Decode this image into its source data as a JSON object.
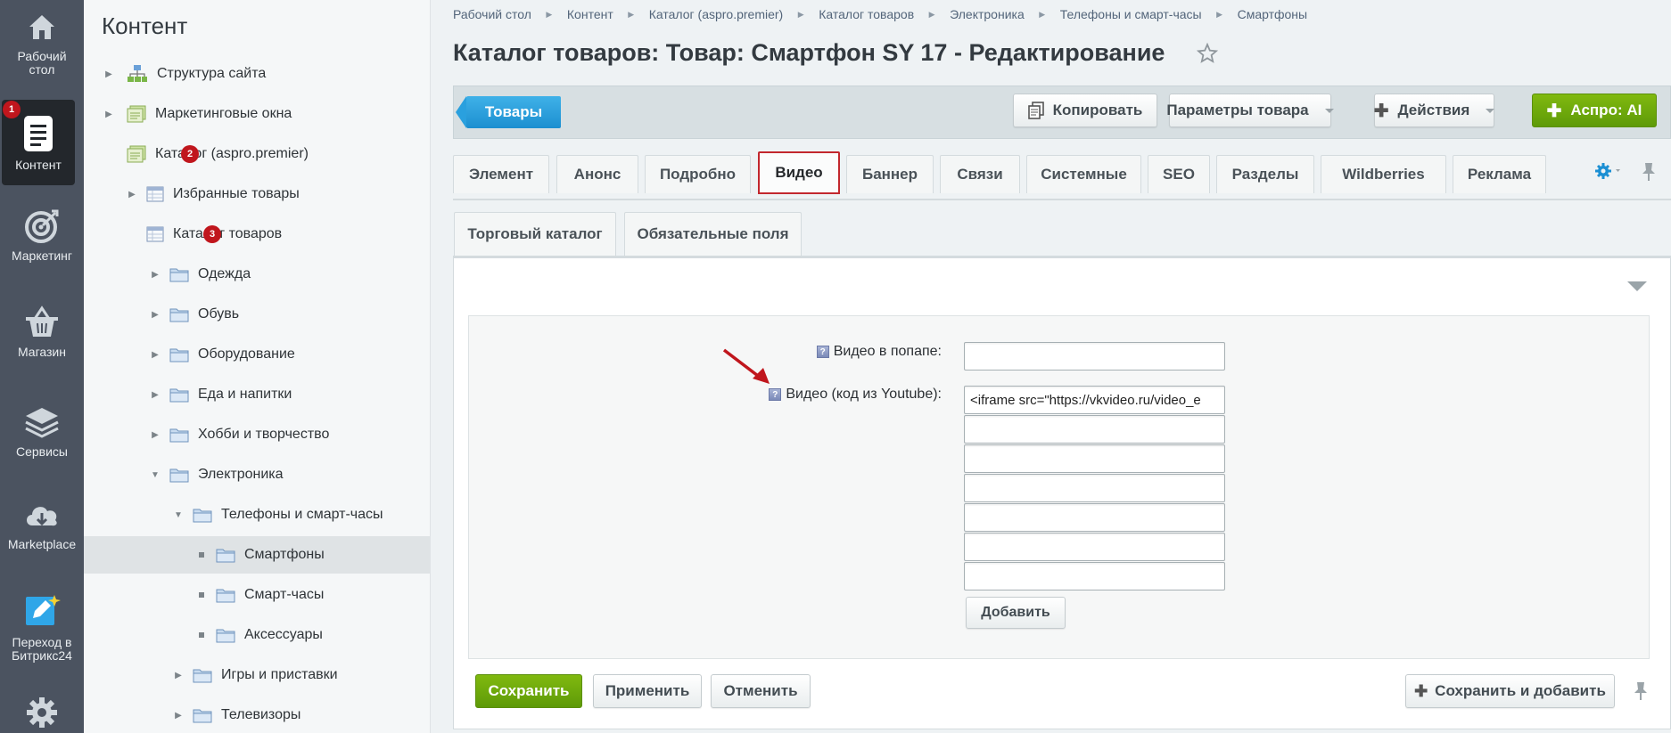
{
  "rail": {
    "items": [
      {
        "label_line1": "Рабочий",
        "label_line2": "стол",
        "icon": "home-icon"
      },
      {
        "label_line1": "Контент",
        "label_line2": "",
        "icon": "document-icon",
        "badge": "1"
      },
      {
        "label_line1": "Маркетинг",
        "label_line2": "",
        "icon": "target-icon"
      },
      {
        "label_line1": "Магазин",
        "label_line2": "",
        "icon": "basket-icon"
      },
      {
        "label_line1": "Сервисы",
        "label_line2": "",
        "icon": "layers-icon"
      },
      {
        "label_line1": "Marketplace",
        "label_line2": "",
        "icon": "cloud-download-icon"
      },
      {
        "label_line1": "Переход в",
        "label_line2": "Битрикс24",
        "icon": "bitrix24-icon"
      },
      {
        "label_line1": "",
        "label_line2": "",
        "icon": "gear-icon"
      }
    ]
  },
  "tree": {
    "title": "Контент",
    "nodes": [
      {
        "label": "Структура сайта"
      },
      {
        "label": "Маркетинговые окна"
      },
      {
        "label": "Каталог (aspro.premier)",
        "badge": "2"
      },
      {
        "label": "Избранные товары"
      },
      {
        "label": "Каталог товаров",
        "badge": "3"
      },
      {
        "label": "Одежда"
      },
      {
        "label": "Обувь"
      },
      {
        "label": "Оборудование"
      },
      {
        "label": "Еда и напитки"
      },
      {
        "label": "Хобби и творчество"
      },
      {
        "label": "Электроника"
      },
      {
        "label": "Телефоны и смарт-часы"
      },
      {
        "label": "Смартфоны"
      },
      {
        "label": "Смарт-часы"
      },
      {
        "label": "Аксессуары"
      },
      {
        "label": "Игры и приставки"
      },
      {
        "label": "Телевизоры"
      }
    ]
  },
  "breadcrumb": [
    "Рабочий стол",
    "Контент",
    "Каталог (aspro.premier)",
    "Каталог товаров",
    "Электроника",
    "Телефоны и смарт-часы",
    "Смартфоны"
  ],
  "page_title": "Каталог товаров: Товар: Смартфон SY 17 - Редактирование",
  "toolbar": {
    "products": "Товары",
    "copy": "Копировать",
    "params": "Параметры товара",
    "actions": "Действия",
    "aspro_ai": "Аспро: AI"
  },
  "tabs": [
    "Элемент",
    "Анонс",
    "Подробно",
    "Видео",
    "Баннер",
    "Связи",
    "Системные",
    "SEO",
    "Разделы",
    "Wildberries",
    "Реклама"
  ],
  "subtabs": [
    "Торговый каталог",
    "Обязательные поля"
  ],
  "form": {
    "popup_label": "Видео в попапе:",
    "popup_value": "",
    "youtube_label": "Видео (код из Youtube):",
    "youtube_values": [
      "<iframe src=\"https://vkvideo.ru/video_e",
      "",
      "",
      "",
      "",
      "",
      ""
    ],
    "add_label": "Добавить",
    "help_glyph": "?"
  },
  "footer": {
    "save": "Сохранить",
    "apply": "Применить",
    "cancel": "Отменить",
    "save_add": "Сохранить и добавить"
  },
  "colors": {
    "accent_red": "#c2272d",
    "green": "#6aa70c",
    "blue": "#1c8fd0"
  }
}
